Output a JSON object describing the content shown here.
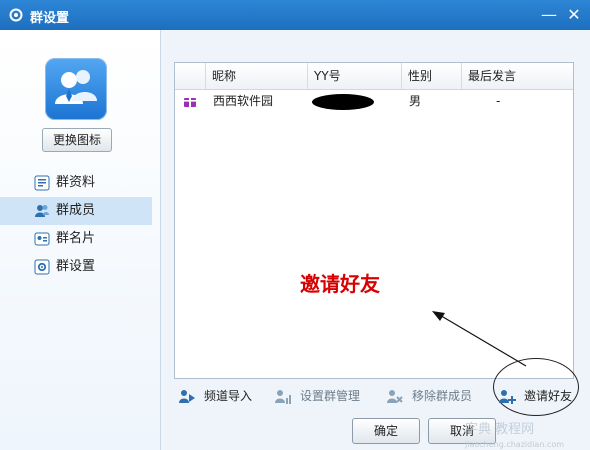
{
  "window": {
    "title": "群设置",
    "minimize_label": "—",
    "close_label": "✕"
  },
  "sidebar": {
    "change_icon_label": "更换图标",
    "items": [
      {
        "label": "群资料",
        "icon": "group-info-icon"
      },
      {
        "label": "群成员",
        "icon": "group-members-icon",
        "active": true
      },
      {
        "label": "群名片",
        "icon": "group-card-icon"
      },
      {
        "label": "群设置",
        "icon": "group-settings-icon"
      }
    ]
  },
  "table": {
    "headers": [
      "昵称",
      "YY号",
      "性别",
      "最后发言"
    ],
    "rows": [
      {
        "nickname": "西西软件园",
        "yy_number": "",
        "gender": "男",
        "last_speak": "-"
      }
    ]
  },
  "annotation": {
    "text": "邀请好友"
  },
  "toolbar": {
    "channel_import": "频道导入",
    "set_admin": "设置群管理",
    "remove_member": "移除群成员",
    "invite_friend": "邀请好友"
  },
  "footer": {
    "confirm": "确定",
    "cancel": "取消"
  },
  "watermark": {
    "text": "字典 教程网",
    "url_text": "jiaocheng.chazidian.com"
  },
  "colors": {
    "titlebar": "#2e86d6",
    "annotation": "#d80000",
    "active_nav": "#cfe4f7"
  }
}
